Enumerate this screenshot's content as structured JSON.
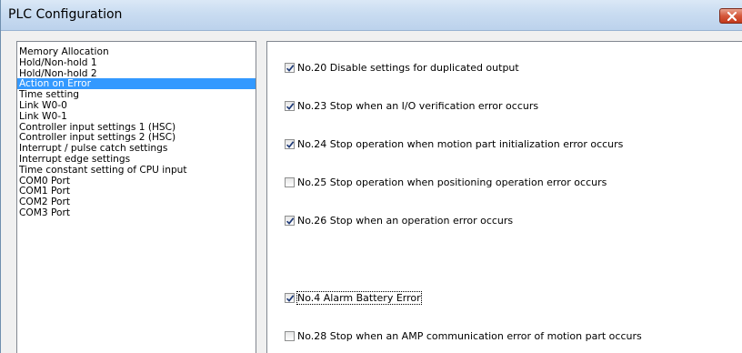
{
  "window": {
    "title": "PLC Configuration",
    "close_icon": "close-icon"
  },
  "tree": {
    "items": [
      {
        "label": "Memory Allocation",
        "selected": false
      },
      {
        "label": "Hold/Non-hold 1",
        "selected": false
      },
      {
        "label": "Hold/Non-hold 2",
        "selected": false
      },
      {
        "label": "Action on Error",
        "selected": true
      },
      {
        "label": "Time setting",
        "selected": false
      },
      {
        "label": "Link W0-0",
        "selected": false
      },
      {
        "label": "Link W0-1",
        "selected": false
      },
      {
        "label": "Controller input settings 1 (HSC)",
        "selected": false
      },
      {
        "label": "Controller input settings 2 (HSC)",
        "selected": false
      },
      {
        "label": "Interrupt / pulse catch settings",
        "selected": false
      },
      {
        "label": "Interrupt edge settings",
        "selected": false
      },
      {
        "label": "Time constant setting of CPU input",
        "selected": false
      },
      {
        "label": "COM0 Port",
        "selected": false
      },
      {
        "label": "COM1 Port",
        "selected": false
      },
      {
        "label": "COM2 Port",
        "selected": false
      },
      {
        "label": "COM3 Port",
        "selected": false
      }
    ]
  },
  "settings": {
    "options": [
      {
        "label": "No.20 Disable settings for duplicated output",
        "checked": true
      },
      {
        "label": "No.23 Stop when an I/O verification error occurs",
        "checked": true
      },
      {
        "label": "No.24 Stop operation when motion part initialization error occurs",
        "checked": true
      },
      {
        "label": "No.25 Stop operation when positioning operation error occurs",
        "checked": false
      },
      {
        "label": "No.26 Stop when an operation error occurs",
        "checked": true
      },
      {
        "label": "No.4 Alarm Battery Error",
        "checked": true
      },
      {
        "label": "No.28 Stop when an AMP communication error of motion part occurs",
        "checked": false
      }
    ]
  },
  "colors": {
    "selection": "#3399ff",
    "check": "#1f3a78"
  }
}
